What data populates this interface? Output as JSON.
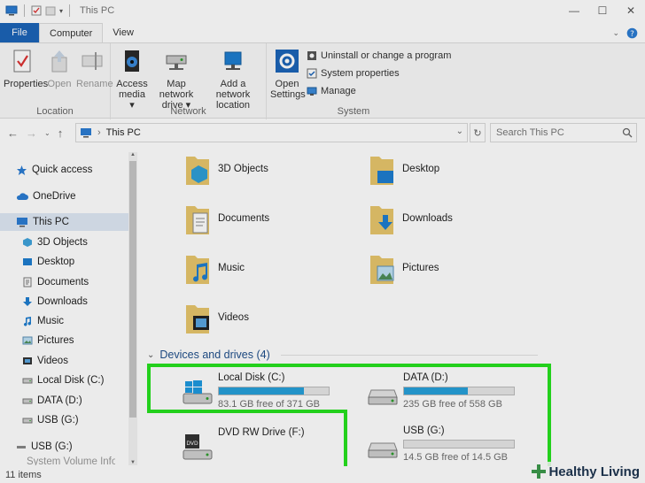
{
  "window": {
    "title": "This PC",
    "min_glyph": "—",
    "max_glyph": "☐",
    "close_glyph": "✕"
  },
  "ribbon_tabs": {
    "file": "File",
    "computer": "Computer",
    "view": "View"
  },
  "ribbon": {
    "location": {
      "label": "Location",
      "properties": "Properties",
      "open": "Open",
      "rename": "Rename"
    },
    "network": {
      "label": "Network",
      "access_media": "Access media",
      "map_network_drive": "Map network drive",
      "add_network_location": "Add a network location"
    },
    "system": {
      "label": "System",
      "open_settings": "Open Settings",
      "uninstall": "Uninstall or change a program",
      "system_properties": "System properties",
      "manage": "Manage"
    }
  },
  "address": {
    "path": "This PC",
    "search_placeholder": "Search This PC"
  },
  "sidebar": {
    "items": [
      {
        "label": "Quick access",
        "icon": "star-icon"
      },
      {
        "label": "OneDrive",
        "icon": "cloud-icon"
      },
      {
        "label": "This PC",
        "icon": "computer-icon"
      },
      {
        "label": "3D Objects",
        "icon": "cube-icon"
      },
      {
        "label": "Desktop",
        "icon": "desktop-icon"
      },
      {
        "label": "Documents",
        "icon": "document-icon"
      },
      {
        "label": "Downloads",
        "icon": "download-icon"
      },
      {
        "label": "Music",
        "icon": "music-icon"
      },
      {
        "label": "Pictures",
        "icon": "picture-icon"
      },
      {
        "label": "Videos",
        "icon": "video-icon"
      },
      {
        "label": "Local Disk (C:)",
        "icon": "drive-icon"
      },
      {
        "label": "DATA (D:)",
        "icon": "drive-icon"
      },
      {
        "label": "USB (G:)",
        "icon": "drive-icon"
      },
      {
        "label": "USB (G:)",
        "icon": "usb-icon"
      },
      {
        "label": "System Volume Information",
        "icon": "folder-icon"
      }
    ]
  },
  "folders": [
    {
      "label": "3D Objects",
      "icon": "cube-folder-icon"
    },
    {
      "label": "Desktop",
      "icon": "desktop-folder-icon"
    },
    {
      "label": "Documents",
      "icon": "documents-folder-icon"
    },
    {
      "label": "Downloads",
      "icon": "downloads-folder-icon"
    },
    {
      "label": "Music",
      "icon": "music-folder-icon"
    },
    {
      "label": "Pictures",
      "icon": "pictures-folder-icon"
    },
    {
      "label": "Videos",
      "icon": "videos-folder-icon"
    }
  ],
  "devices_section": {
    "title": "Devices and drives (4)"
  },
  "drives": [
    {
      "name": "Local Disk (C:)",
      "free_text": "83.1 GB free of 371 GB",
      "used_fraction": 0.776,
      "icon": "windows-drive-icon"
    },
    {
      "name": "DATA (D:)",
      "free_text": "235 GB free of 558 GB",
      "used_fraction": 0.579,
      "icon": "drive-icon"
    },
    {
      "name": "DVD RW Drive (F:)",
      "free_text": "",
      "used_fraction": null,
      "icon": "dvd-drive-icon"
    },
    {
      "name": "USB (G:)",
      "free_text": "14.5 GB free of 14.5 GB",
      "used_fraction": 0.0,
      "icon": "drive-icon"
    }
  ],
  "status": {
    "items": "11 items"
  },
  "watermark": {
    "text": "Healthy Living"
  },
  "colors": {
    "accent": "#1c64b8",
    "bar_fill": "#26a0da",
    "highlight": "#27e21f"
  }
}
